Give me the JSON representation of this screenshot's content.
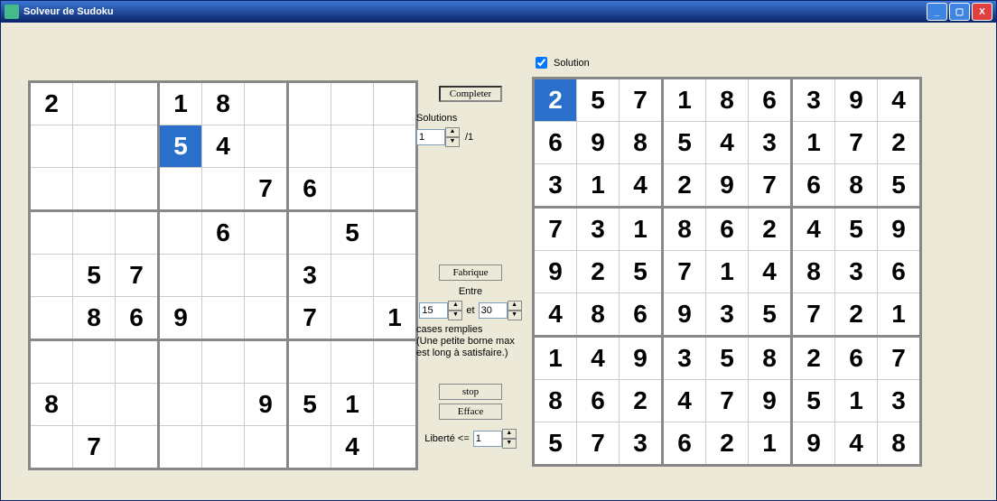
{
  "window": {
    "title": "Solveur de Sudoku"
  },
  "checkbox": {
    "solution_label": "Solution",
    "checked": true
  },
  "buttons": {
    "completer": "Completer",
    "fabrique": "Fabrique",
    "stop": "stop",
    "efface": "Efface"
  },
  "labels": {
    "solutions": "Solutions",
    "slash_total": "/1",
    "entre": "Entre",
    "et": "et",
    "cases_remplies": "cases remplies\n(Une petite borne max est long à satisfaire.)",
    "liberte": "Liberté <="
  },
  "spinners": {
    "solutions": "1",
    "entre_min": "15",
    "entre_max": "30",
    "liberte": "1"
  },
  "puzzle_grid": [
    [
      "2",
      "",
      "",
      "1",
      "8",
      "",
      "",
      "",
      ""
    ],
    [
      "",
      "",
      "",
      "5",
      "4",
      "",
      "",
      "",
      ""
    ],
    [
      "",
      "",
      "",
      "",
      "",
      "7",
      "6",
      "",
      ""
    ],
    [
      "",
      "",
      "",
      "",
      "6",
      "",
      "",
      "5",
      ""
    ],
    [
      "",
      "5",
      "7",
      "",
      "",
      "",
      "3",
      "",
      ""
    ],
    [
      "",
      "8",
      "6",
      "9",
      "",
      "",
      "7",
      "",
      "1"
    ],
    [
      "",
      "",
      "",
      "",
      "",
      "",
      "",
      "",
      ""
    ],
    [
      "8",
      "",
      "",
      "",
      "",
      "9",
      "5",
      "1",
      ""
    ],
    [
      "",
      "7",
      "",
      "",
      "",
      "",
      "",
      "4",
      ""
    ]
  ],
  "puzzle_selected": [
    1,
    3
  ],
  "solution_grid": [
    [
      "2",
      "5",
      "7",
      "1",
      "8",
      "6",
      "3",
      "9",
      "4"
    ],
    [
      "6",
      "9",
      "8",
      "5",
      "4",
      "3",
      "1",
      "7",
      "2"
    ],
    [
      "3",
      "1",
      "4",
      "2",
      "9",
      "7",
      "6",
      "8",
      "5"
    ],
    [
      "7",
      "3",
      "1",
      "8",
      "6",
      "2",
      "4",
      "5",
      "9"
    ],
    [
      "9",
      "2",
      "5",
      "7",
      "1",
      "4",
      "8",
      "3",
      "6"
    ],
    [
      "4",
      "8",
      "6",
      "9",
      "3",
      "5",
      "7",
      "2",
      "1"
    ],
    [
      "1",
      "4",
      "9",
      "3",
      "5",
      "8",
      "2",
      "6",
      "7"
    ],
    [
      "8",
      "6",
      "2",
      "4",
      "7",
      "9",
      "5",
      "1",
      "3"
    ],
    [
      "5",
      "7",
      "3",
      "6",
      "2",
      "1",
      "9",
      "4",
      "8"
    ]
  ],
  "solution_selected": [
    0,
    0
  ]
}
